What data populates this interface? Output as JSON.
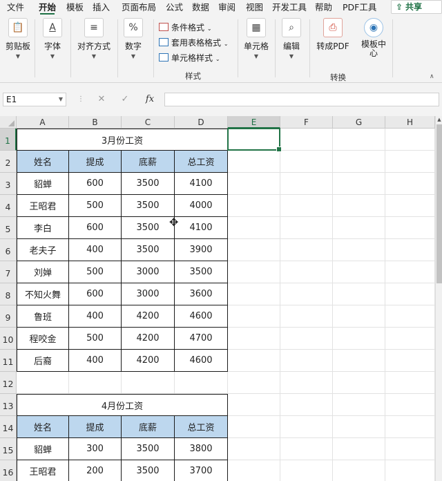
{
  "tabs": [
    "文件",
    "开始",
    "模板",
    "插入",
    "页面布局",
    "公式",
    "数据",
    "审阅",
    "视图",
    "开发工具",
    "帮助",
    "PDF工具"
  ],
  "active_tab": "开始",
  "share_label": "共享",
  "ribbon": {
    "clipboard": "剪贴板",
    "font": "字体",
    "alignment": "对齐方式",
    "number": "数字",
    "conditional_format": "条件格式",
    "table_format": "套用表格格式",
    "cell_styles": "单元格样式",
    "styles_group": "样式",
    "cells": "单元格",
    "editing": "编辑",
    "to_pdf": "转成PDF",
    "template_center": "模板中心",
    "convert_group": "转换"
  },
  "name_box": "E1",
  "formula_icons": {
    "cancel": "✕",
    "confirm": "✓",
    "fx": "fx"
  },
  "columns": [
    "A",
    "B",
    "C",
    "D",
    "E",
    "F",
    "G",
    "H"
  ],
  "rows": [
    "1",
    "2",
    "3",
    "4",
    "5",
    "6",
    "7",
    "8",
    "9",
    "10",
    "11",
    "12",
    "13",
    "14",
    "15",
    "16"
  ],
  "selected_cell": "E1",
  "table1": {
    "title": "3月份工资",
    "headers": [
      "姓名",
      "提成",
      "底薪",
      "总工资"
    ],
    "rows": [
      [
        "貂蝉",
        "600",
        "3500",
        "4100"
      ],
      [
        "王昭君",
        "500",
        "3500",
        "4000"
      ],
      [
        "李白",
        "600",
        "3500",
        "4100"
      ],
      [
        "老夫子",
        "400",
        "3500",
        "3900"
      ],
      [
        "刘婵",
        "500",
        "3000",
        "3500"
      ],
      [
        "不知火舞",
        "600",
        "3000",
        "3600"
      ],
      [
        "鲁班",
        "400",
        "4200",
        "4600"
      ],
      [
        "程咬金",
        "500",
        "4200",
        "4700"
      ],
      [
        "后裔",
        "400",
        "4200",
        "4600"
      ]
    ]
  },
  "table2": {
    "title": "4月份工资",
    "headers": [
      "姓名",
      "提成",
      "底薪",
      "总工资"
    ],
    "rows": [
      [
        "貂蝉",
        "300",
        "3500",
        "3800"
      ],
      [
        "王昭君",
        "200",
        "3500",
        "3700"
      ]
    ]
  },
  "icons": {
    "clipboard": "clipboard-icon",
    "font": "font-color-icon",
    "alignment": "align-icon",
    "number": "percent-icon",
    "cells": "table-icon",
    "editing": "search-icon",
    "pdf": "pdf-icon",
    "template": "template-icon"
  }
}
